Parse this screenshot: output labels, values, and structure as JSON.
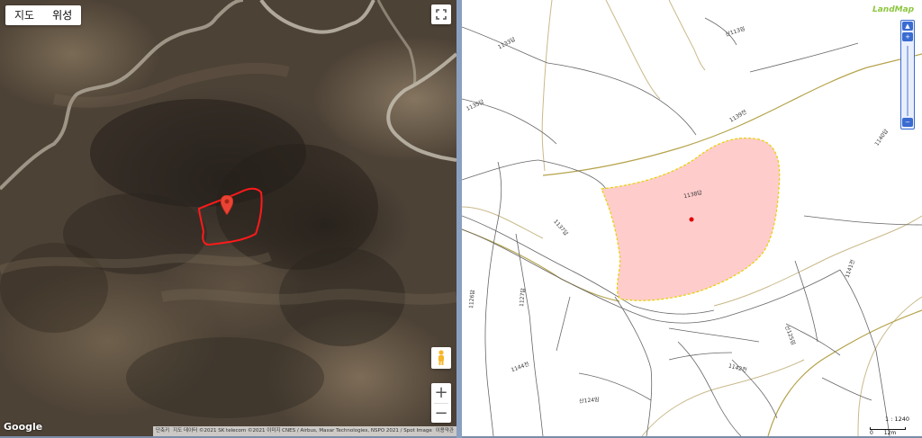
{
  "satellite_panel": {
    "map_type_tabs": [
      {
        "label": "지도",
        "active": false
      },
      {
        "label": "위성",
        "active": true
      }
    ],
    "logo_text": "Google",
    "attribution": [
      "단축키",
      "지도 데이터 ©2021 SK telecom ©2021 이미지 CNES / Airbus, Maxar Technologies, NSPO 2021 / Spot Image",
      "이용약관"
    ],
    "zoom_in_label": "+",
    "zoom_out_label": "−",
    "marker_color": "#ea4335",
    "outline_color": "#ff1a1a"
  },
  "cadastral_panel": {
    "brand": "LandMap",
    "scale_ratio": "1 : 1240",
    "scale_bar_labels": [
      "0",
      "12m"
    ],
    "highlight_fill": "#ffcccc",
    "highlight_border": "#e6d200",
    "center_point_color": "#e00000",
    "parcels": {
      "p1133": "1133답",
      "p113": "산113임",
      "p1135": "1135답",
      "p1139": "1139전",
      "p1140": "1140답",
      "p1138": "1138답",
      "p1137": "1137답",
      "p1141": "1141전",
      "p1126": "1126답",
      "p1127": "1127답",
      "p125": "산125임",
      "p1144": "1144전",
      "p1142": "1142전",
      "p124": "산124임"
    }
  }
}
